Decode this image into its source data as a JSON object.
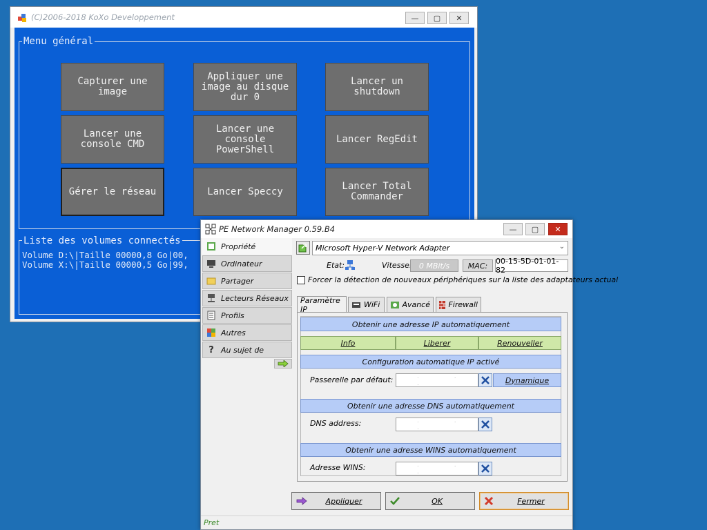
{
  "colors": {
    "desktop": "#1e6fb5",
    "menu_bg": "#0a5fd6",
    "menu_button": "#6e6e6e",
    "blue_header": "#b6ccf7",
    "green_button": "#cfe8a8",
    "close_red": "#c42b1c"
  },
  "back_window": {
    "title": "(C)2006-2018 KoXo Developpement",
    "menu_group_label": "Menu général",
    "buttons": [
      {
        "label": "Capturer une image"
      },
      {
        "label": "Appliquer une image au disque dur 0"
      },
      {
        "label": "Lancer un shutdown"
      },
      {
        "label": "Lancer une console CMD"
      },
      {
        "label": "Lancer une console PowerShell"
      },
      {
        "label": "Lancer RegEdit"
      },
      {
        "label": "Gérer le réseau"
      },
      {
        "label": "Lancer Speccy"
      },
      {
        "label": "Lancer Total Commander"
      }
    ],
    "volumes_label": "Liste des volumes connectés",
    "volumes": [
      "Volume D:\\|Taille 00000,8 Go|00,",
      "Volume X:\\|Taille 00000,5 Go|99,"
    ]
  },
  "front_window": {
    "title": "PE Network Manager 0.59.B4",
    "sidebar": [
      {
        "label": "Propriété",
        "icon": "network-properties-icon"
      },
      {
        "label": "Ordinateur",
        "icon": "computer-icon"
      },
      {
        "label": "Partager",
        "icon": "folder-share-icon"
      },
      {
        "label": "Lecteurs Réseaux",
        "icon": "network-drive-icon"
      },
      {
        "label": "Profils",
        "icon": "profile-list-icon"
      },
      {
        "label": "Autres",
        "icon": "color-blocks-icon"
      },
      {
        "label": "Au sujet de",
        "icon": "help-icon"
      }
    ],
    "adapter": "Microsoft Hyper-V Network Adapter",
    "status": {
      "etat_label": "Etat:",
      "vitesse_label": "Vitesse:",
      "vitesse_value": "0 MBit/s",
      "mac_label": "MAC:",
      "mac_value": "00-15-5D-01-01-82"
    },
    "force_checkbox_label": "Forcer la détection de nouveaux périphériques sur la liste des adaptateurs actual",
    "tabs": [
      {
        "label": "Paramètre IP"
      },
      {
        "label": "WiFi",
        "icon": "wifi-icon"
      },
      {
        "label": "Avancé",
        "icon": "advanced-icon"
      },
      {
        "label": "Firewall",
        "icon": "firewall-icon"
      }
    ],
    "ip": {
      "obtain_ip": "Obtenir une adresse IP automatiquement",
      "info": "Info",
      "liberer": "Liberer",
      "renouveller": "Renouveller",
      "autoconfig": "Configuration automatique IP activé",
      "gateway_label": "Passerelle par défaut:",
      "dynamique": "Dynamique",
      "obtain_dns": "Obtenir une adresse DNS automatiquement",
      "dns_label": "DNS address:",
      "obtain_wins": "Obtenir une adresse WINS automatiquement",
      "wins_label": "Adresse WINS:",
      "ip_placeholder": ". . ."
    },
    "actions": {
      "apply": "Appliquer",
      "ok": "OK",
      "close": "Fermer"
    },
    "statusbar": "Pret"
  }
}
